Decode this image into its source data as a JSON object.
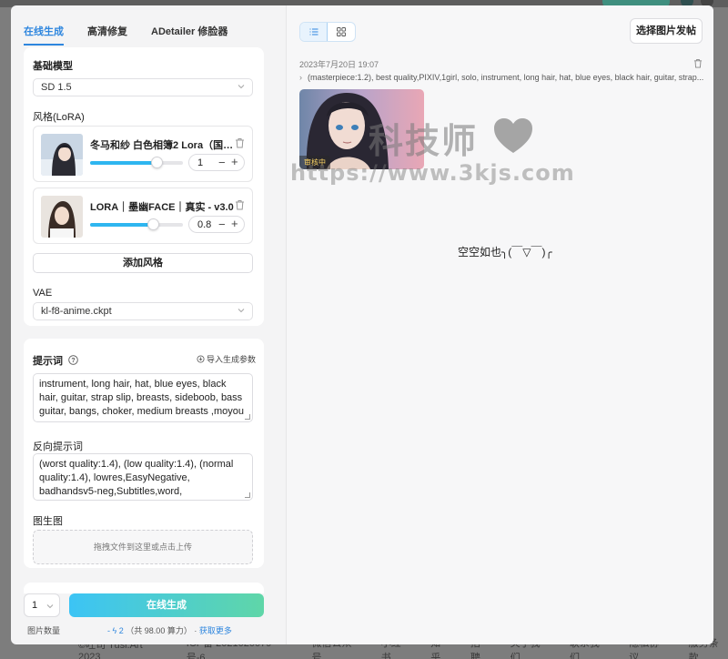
{
  "tabs": [
    {
      "label": "在线生成",
      "active": true
    },
    {
      "label": "高清修复",
      "active": false
    },
    {
      "label": "ADetailer 修脸器",
      "active": false
    }
  ],
  "base_model": {
    "label": "基础模型",
    "value": "SD 1.5"
  },
  "lora": {
    "label": "风格(LoRA)",
    "items": [
      {
        "title": "冬马和纱 白色相簿2 Lora（国内独...",
        "weight": "1",
        "level": 0.72
      },
      {
        "title": "LORA｜墨幽FACE｜真实 - v3.0",
        "weight": "0.8",
        "level": 0.68
      }
    ],
    "add_label": "添加风格"
  },
  "vae": {
    "label": "VAE",
    "value": "kl-f8-anime.ckpt"
  },
  "prompt": {
    "label": "提示词",
    "import_label": "导入生成参数",
    "value": "instrument, long hair, hat, blue eyes, black hair, guitar, strap slip, breasts, sideboob, bass guitar, bangs, choker, medium breasts ,moyou"
  },
  "negative_prompt": {
    "label": "反向提示词",
    "value": "(worst quality:1.4), (low quality:1.4), (normal quality:1.4), lowres,EasyNegative, badhandsv5-neg,Subtitles,word,"
  },
  "img2img": {
    "label": "图生图",
    "upload_hint": "拖拽文件到这里或点击上传"
  },
  "generate": {
    "count_value": "1",
    "count_label": "图片数量",
    "button_label": "在线生成",
    "cost": "2",
    "cost_detail": "（共 98.00 算力）",
    "more_label": "获取更多"
  },
  "right": {
    "post_button": "选择图片发帖",
    "date": "2023年7月20日 19:07",
    "prompt_preview": "(masterpiece:1.2), best quality,PIXIV,1girl, solo, instrument, long hair, hat, blue eyes, black hair, guitar, strap...",
    "review_badge": "审核中",
    "empty_message": "空空如也╮(￣▽￣)╭",
    "watermark_cn": "科技师",
    "watermark_url": "https://www.3kjs.com"
  },
  "background_footer": [
    "©吐司 Tusi.Art 2023",
    "ICP备 2021020079 号-6",
    "微信公众号",
    "小红书",
    "知乎",
    "招聘",
    "关于我们",
    "联系我们",
    "隐私协议",
    "服务条款"
  ],
  "colors": {
    "accent": "#2e86de",
    "gradient_start": "#3cc4f5",
    "gradient_end": "#5fd6a8",
    "slider": "#2eb6f0",
    "badge_text": "#ffd866"
  }
}
